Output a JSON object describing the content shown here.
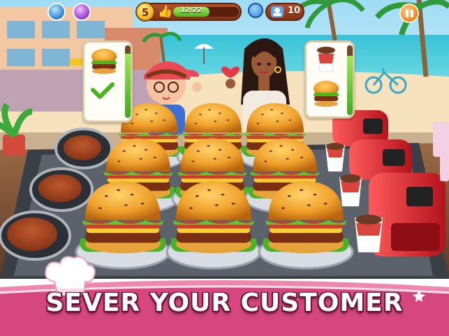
{
  "hud": {
    "level": "5",
    "xp_text": "12/22",
    "xp_progress": 0.55,
    "guest_count": "10",
    "pause_icon": "pause-icon",
    "thumb_icon": "thumbs-up-icon",
    "guest_icon": "guest-icon"
  },
  "orders": [
    {
      "customer": "boy-customer",
      "items": [
        "burger-icon"
      ],
      "status": "check-icon",
      "patience": 0.88
    },
    {
      "customer": "woman-customer",
      "items": [
        "soda-cup-icon",
        "burger-icon"
      ],
      "patience": 0.85
    }
  ],
  "banner": {
    "text": "SEVER YOUR CUSTOMER"
  },
  "colors": {
    "banner": "#d6477f",
    "counter": "#7a5236",
    "accent": "#ff7a1a",
    "bar_fill": "#5bc223"
  }
}
